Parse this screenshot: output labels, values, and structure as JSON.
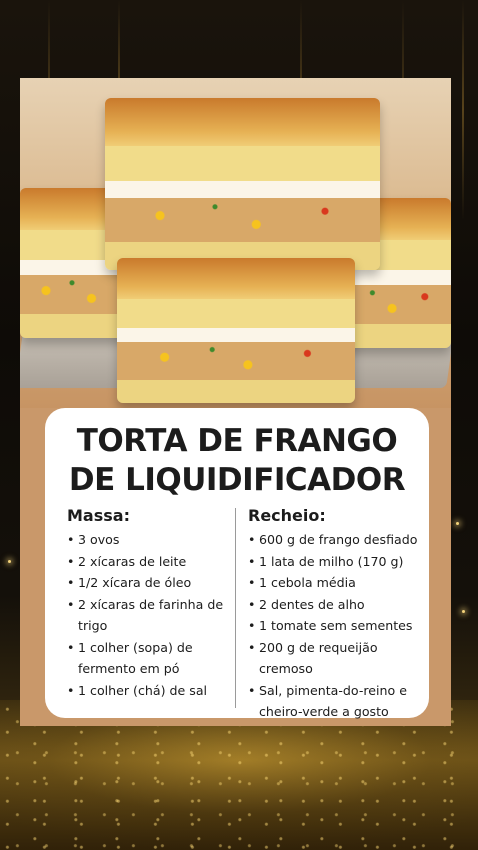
{
  "recipe": {
    "title_line1": "TORTA DE FRANGO",
    "title_line2": "DE LIQUIDIFICADOR",
    "massa": {
      "heading": "Massa:",
      "items": [
        "3 ovos",
        "2 xícaras de leite",
        "1/2 xícara de óleo",
        "2 xícaras de farinha de trigo",
        "1 colher (sopa) de fermento em pó",
        "1 colher (chá) de sal"
      ]
    },
    "recheio": {
      "heading": "Recheio:",
      "items": [
        "600 g de frango desfiado",
        "1 lata de milho (170 g)",
        "1 cebola média",
        "2 dentes de alho",
        "1 tomate sem sementes",
        "200 g de requeijão cremoso",
        "Sal, pimenta-do-reino e cheiro-verde a gosto"
      ]
    }
  },
  "colors": {
    "background": "#0a0806",
    "gold_accent": "#d6aa3c",
    "card_text": "#1c1c1c",
    "card_background": "#ffffff"
  },
  "images": {
    "photo": "chicken-pie-slices-photo"
  }
}
